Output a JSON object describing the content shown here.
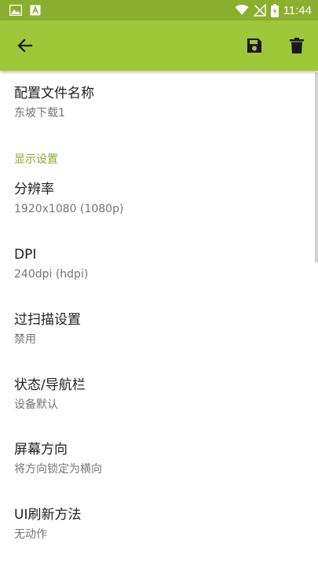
{
  "status_bar": {
    "time": "11:44",
    "icons": [
      "image-icon",
      "a-icon",
      "wifi-icon",
      "no-signal-icon",
      "battery-charging-icon"
    ]
  },
  "toolbar": {
    "back_icon": "back-arrow-icon",
    "save_icon": "save-icon",
    "delete_icon": "delete-icon",
    "bg_color": "#a0c63a"
  },
  "profile_name": {
    "title": "配置文件名称",
    "summary": "东坡下载1"
  },
  "section_display": {
    "label": "显示设置",
    "color": "#8aab2a"
  },
  "items": [
    {
      "title": "分辨率",
      "summary": "1920x1080 (1080p)"
    },
    {
      "title": "DPI",
      "summary": "240dpi (hdpi)"
    },
    {
      "title": "过扫描设置",
      "summary": "禁用"
    },
    {
      "title": "状态/导航栏",
      "summary": "设备默认"
    },
    {
      "title": "屏幕方向",
      "summary": "将方向锁定为横向"
    },
    {
      "title": "UI刷新方法",
      "summary": "无动作"
    }
  ]
}
